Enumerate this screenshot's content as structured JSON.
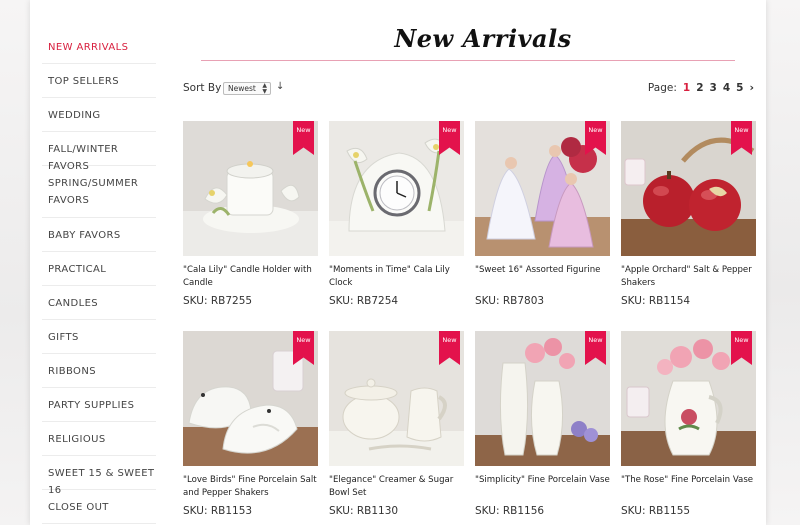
{
  "sidebar": {
    "items": [
      {
        "label": "NEW ARRIVALS",
        "active": true
      },
      {
        "label": "TOP SELLERS"
      },
      {
        "label": "WEDDING"
      },
      {
        "label": "FALL/WINTER FAVORS"
      },
      {
        "label": "SPRING/SUMMER FAVORS"
      },
      {
        "label": "BABY FAVORS"
      },
      {
        "label": "PRACTICAL"
      },
      {
        "label": "CANDLES"
      },
      {
        "label": "GIFTS"
      },
      {
        "label": "RIBBONS"
      },
      {
        "label": "PARTY SUPPLIES"
      },
      {
        "label": "RELIGIOUS"
      },
      {
        "label": "SWEET 15 & SWEET 16"
      },
      {
        "label": "CLOSE OUT"
      }
    ]
  },
  "header": {
    "title": "New Arrivals"
  },
  "toolbar": {
    "sort_label": "Sort By",
    "sort_value": "Newest",
    "page_label": "Page:",
    "pages": [
      "1",
      "2",
      "3",
      "4",
      "5"
    ],
    "current_page": "1"
  },
  "products": [
    {
      "name": "\"Cala Lily\" Candle Holder with Candle",
      "sku": "SKU: RB7255",
      "badge": "New"
    },
    {
      "name": "\"Moments in Time\" Cala Lily Clock",
      "sku": "SKU: RB7254",
      "badge": "New"
    },
    {
      "name": "\"Sweet 16\" Assorted Figurine",
      "sku": "SKU: RB7803",
      "badge": "New"
    },
    {
      "name": "\"Apple Orchard\" Salt & Pepper Shakers",
      "sku": "SKU: RB1154",
      "badge": "New"
    },
    {
      "name": "\"Love Birds\" Fine Porcelain Salt and Pepper Shakers",
      "sku": "SKU: RB1153",
      "badge": "New"
    },
    {
      "name": "\"Elegance\" Creamer & Sugar Bowl Set",
      "sku": "SKU: RB1130",
      "badge": "New"
    },
    {
      "name": "\"Simplicity\" Fine Porcelain Vase",
      "sku": "SKU: RB1156",
      "badge": "New"
    },
    {
      "name": "\"The Rose\" Fine Porcelain Vase",
      "sku": "SKU: RB1155",
      "badge": "New"
    }
  ],
  "colors": {
    "accent": "#d8203f",
    "badge": "#e3124c",
    "rule": "#e8a1b4"
  }
}
